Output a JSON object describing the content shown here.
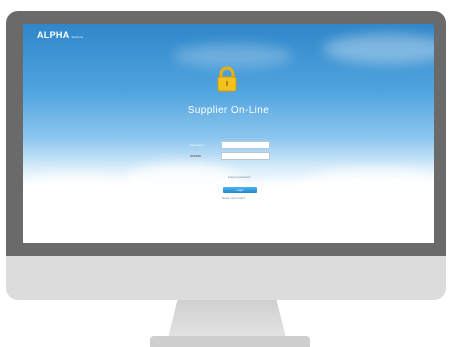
{
  "brand": {
    "name": "ALPHA",
    "tagline": "Systems"
  },
  "page": {
    "title": "Supplier On-Line"
  },
  "login_form": {
    "username_label": "Username",
    "password_label": "ID/PWD",
    "username_value": "",
    "password_value": "",
    "forgot_link": "Forgot password",
    "submit_label": "Login",
    "help_link": "Need more help?"
  },
  "colors": {
    "sky_top": "#2f86c9",
    "bezel": "#6a6a6a",
    "chin": "#dcdcdc",
    "lock": "#f4c21d",
    "button": "#1f88cc"
  },
  "icons": {
    "lock": "padlock-icon"
  }
}
